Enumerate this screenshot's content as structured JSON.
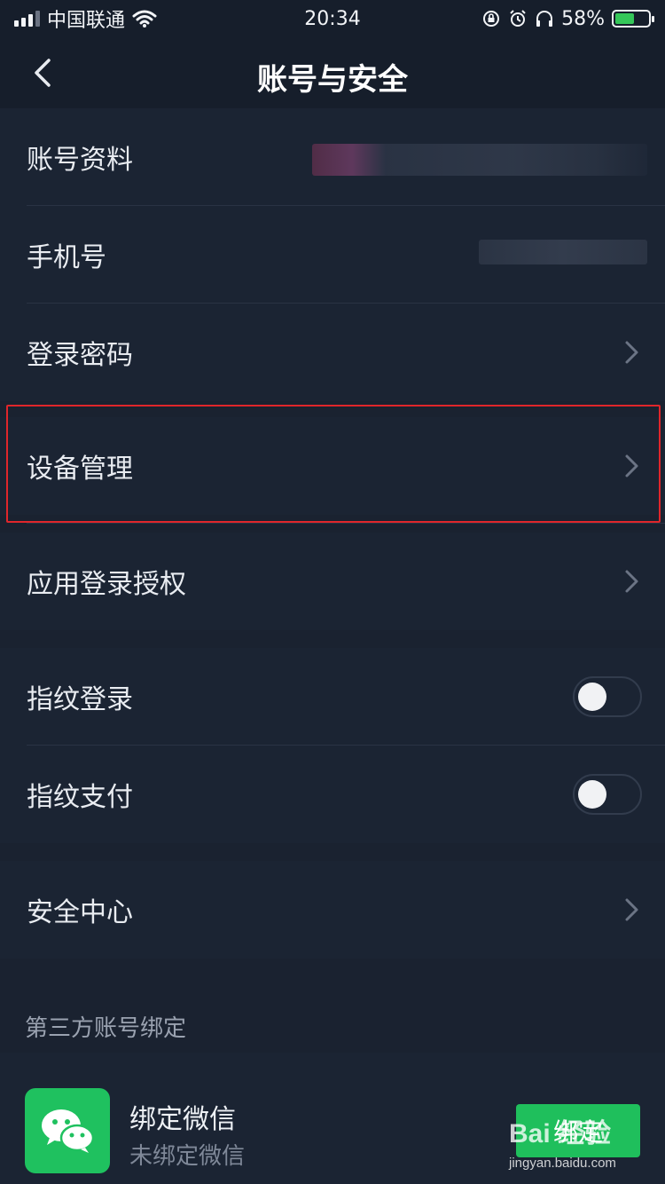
{
  "status_bar": {
    "carrier": "中国联通",
    "time": "20:34",
    "battery": "58%",
    "battery_level": 0.58,
    "icons": [
      "signal-icon",
      "wifi-icon",
      "orientation-lock-icon",
      "alarm-icon",
      "headphones-icon",
      "battery-icon"
    ]
  },
  "nav": {
    "title": "账号与安全",
    "back_icon": "chevron-left-icon"
  },
  "rows": {
    "account_info": {
      "label": "账号资料"
    },
    "phone": {
      "label": "手机号"
    },
    "login_password": {
      "label": "登录密码"
    },
    "device_management": {
      "label": "设备管理"
    },
    "app_login_auth": {
      "label": "应用登录授权"
    },
    "fingerprint_login": {
      "label": "指纹登录",
      "enabled": false
    },
    "fingerprint_pay": {
      "label": "指纹支付",
      "enabled": false
    },
    "security_center": {
      "label": "安全中心"
    }
  },
  "third_party": {
    "caption": "第三方账号绑定",
    "wechat": {
      "title": "绑定微信",
      "subtitle": "未绑定微信",
      "button": "绑定",
      "icon": "wechat-icon"
    }
  },
  "watermark": {
    "main": "Bai 经验",
    "sub": "jingyan.baidu.com"
  },
  "colors": {
    "background": "#1a2230",
    "row": "#1b2433",
    "highlight": "#e0262b",
    "wechat_green": "#1fc15f"
  }
}
